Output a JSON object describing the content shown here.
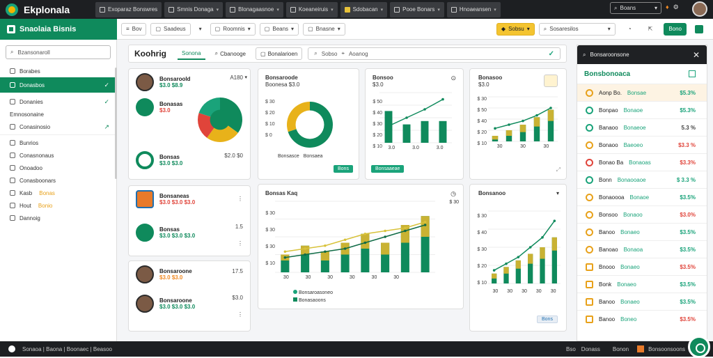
{
  "app": {
    "name": "Ekplonala"
  },
  "top_tabs": [
    {
      "label": "Exoparaz Bonswres"
    },
    {
      "label": "Smnis Donaga"
    },
    {
      "label": "Blonagaasnoe"
    },
    {
      "label": "Koeaneiruis"
    },
    {
      "label": "Sdobacan"
    },
    {
      "label": "Pooe Bonars"
    },
    {
      "label": "Hnoaeansen"
    }
  ],
  "top_search": {
    "placeholder": "Boans"
  },
  "brand": {
    "title": "Snaolaia Bisnis"
  },
  "toolbar": {
    "menu": "Bov",
    "b1": "Saadeus",
    "b2": "Roomnis",
    "b3": "Beans",
    "b4": "Bnasne",
    "b5": "Sobsu",
    "search": "Sosaresilos",
    "action": "Bono"
  },
  "sidebar": {
    "search": "Bzansonaroll",
    "items": [
      {
        "label": "Borabes",
        "trail": ""
      },
      {
        "label": "Donasbos",
        "trail": "✓"
      },
      {
        "label": "Donanies",
        "trail": "✓"
      },
      {
        "label": "Emnosonaine",
        "trail": ""
      },
      {
        "label": "Conasinosio",
        "trail": "↗"
      },
      {
        "label": "Bunrios",
        "trail": ""
      },
      {
        "label": "Conasnonaus",
        "trail": ""
      },
      {
        "label": "Onoadoo",
        "trail": ""
      },
      {
        "label": "Conasboonars",
        "trail": ""
      },
      {
        "label": "Kasb",
        "tag": "Bonas",
        "trail": ""
      },
      {
        "label": "Hout",
        "tag": "Bonio",
        "trail": ""
      },
      {
        "label": "Dannoig",
        "trail": ""
      }
    ]
  },
  "main": {
    "title": "Koohrig",
    "tab_active": "Sonona",
    "tab2": "Cbanooge",
    "tab3": "Bonalarioen",
    "search1": "Sobso",
    "search2": "Aoanog"
  },
  "card_people": {
    "rows": [
      {
        "name": "Bonsaroold",
        "sub": "$3.0 $8.9",
        "num": "A180"
      },
      {
        "name": "Bonasas",
        "sub": "$3.0"
      },
      {
        "name": "Bonsas",
        "sub": "$3.0 $3.0",
        "num": "$2.0 $0"
      }
    ]
  },
  "card_donut": {
    "title": "Bonsaroode",
    "subtitle": "Boonesa $3.0",
    "yticks": [
      "$ 30",
      "$ 20",
      "$ 10",
      "$ 0"
    ],
    "legend": [
      "Bonsasce",
      "Bonsaea"
    ],
    "action": "Bons"
  },
  "card_bar1": {
    "title": "Bonsoo",
    "sub": "$3.0",
    "yticks": [
      "$ 50",
      "$ 40",
      "$ 30",
      "$ 20",
      "$ 10"
    ],
    "xticks": [
      "3.0",
      "3.0",
      "3.0"
    ],
    "action": "Bonsaaeae"
  },
  "card_bar2": {
    "title": "Bonasoo",
    "sub": "$3.0",
    "yticks": [
      "$ 30",
      "$ 50",
      "$ 40",
      "$ 20",
      "$ 10"
    ],
    "xticks": [
      "30",
      "30",
      "30"
    ]
  },
  "card_stores": {
    "rows": [
      {
        "name": "Bonsaneas",
        "sub": "$3.0 $3.0 $3.0"
      },
      {
        "name": "Bonsas",
        "sub": "$3.0 $3.0 $3.0",
        "num": "1.5"
      },
      {
        "name": "Bonsaroone",
        "num": "17.5"
      },
      {
        "name": "Bonsaroone",
        "sub": "$3.0 $3.0 $3.0",
        "num": "$3.0"
      }
    ]
  },
  "card_combo": {
    "title": "Bonsas Kaq",
    "yticks": [
      "$ 30",
      "$ 30",
      "$ 30",
      "$ 10"
    ],
    "xticks": [
      "30",
      "30",
      "30",
      "30",
      "30",
      "30"
    ],
    "legend": [
      "Bonsaroasoneo",
      "Bonasaoons"
    ],
    "note": "$ 30"
  },
  "card_combo2": {
    "title": "Bonsanoo",
    "yticks": [
      "$ 30",
      "$ 40",
      "$ 30",
      "$ 20",
      "$ 10"
    ],
    "xticks": [
      "30",
      "30",
      "30",
      "30",
      "30"
    ],
    "action": "Bons"
  },
  "right": {
    "header": "Bonsaroonsone",
    "sub": "Bonsbonoaca",
    "rows": [
      {
        "name": "Aonp Bo.",
        "sub": "Bonsae",
        "val": "$5.3%",
        "vc": "g",
        "ic": "y",
        "hi": true
      },
      {
        "name": "Bonpao",
        "sub": "Bonaoe",
        "val": "$5.3%",
        "vc": "g",
        "ic": "g"
      },
      {
        "name": "Banaoo",
        "sub": "Bonaeoe",
        "val": "5.3 %",
        "vc": "k",
        "ic": "g"
      },
      {
        "name": "Bonaoo",
        "sub": "Baeoeo",
        "val": "$3.3 %",
        "vc": "r",
        "ic": "y"
      },
      {
        "name": "Bonao Ba",
        "sub": "Bonaoas",
        "val": "$3.3%",
        "vc": "r",
        "ic": "o"
      },
      {
        "name": "Bonn",
        "sub": "Bonaooaoe",
        "val": "$ 3.3 %",
        "vc": "g",
        "ic": "g"
      },
      {
        "name": "Bonaoooa",
        "sub": "Bonaoe",
        "val": "$3.5%",
        "vc": "g",
        "ic": "y"
      },
      {
        "name": "Bonsoo",
        "sub": "Bonaoo",
        "val": "$3.0%",
        "vc": "r",
        "ic": "y"
      },
      {
        "name": "Banoo",
        "sub": "Bonaeo",
        "val": "$3.5%",
        "vc": "g",
        "ic": "y"
      },
      {
        "name": "Banoao",
        "sub": "Bonaoa",
        "val": "$3.5%",
        "vc": "g",
        "ic": "y"
      },
      {
        "name": "Bnooo",
        "sub": "Bonaeo",
        "val": "$3.5%",
        "vc": "r",
        "ic": "y"
      },
      {
        "name": "Bonk",
        "sub": "Bonaeo",
        "val": "$3.5%",
        "vc": "g",
        "ic": "y"
      },
      {
        "name": "Banoo",
        "sub": "Bonaeo",
        "val": "$3.5%",
        "vc": "g",
        "ic": "y"
      },
      {
        "name": "Banoo",
        "sub": "Boneo",
        "val": "$3.5%",
        "vc": "r",
        "ic": "y"
      }
    ]
  },
  "bottom": {
    "left": "Sonaoa | Baona | Boonaec | Beasoo",
    "right1": "Bso",
    "right2": "Donass",
    "right3": "Bonon",
    "right4": "Bonsoonsoons"
  },
  "colors": {
    "primary": "#0f8a5c",
    "accent": "#f4b400",
    "alert": "#e0443a",
    "dark": "#1d1f22"
  },
  "chart_data": [
    {
      "type": "pie",
      "values": [
        35,
        25,
        20,
        20
      ]
    },
    {
      "type": "pie",
      "values": [
        70,
        30
      ]
    },
    {
      "type": "bar",
      "x": [
        1,
        2,
        3,
        4
      ],
      "values": [
        38,
        22,
        26,
        26
      ],
      "line": [
        20,
        30,
        40,
        52
      ]
    },
    {
      "type": "bar",
      "x": [
        1,
        2,
        3,
        4,
        5
      ],
      "series": [
        {
          "values": [
            6,
            12,
            18,
            26,
            34
          ]
        },
        {
          "values": [
            4,
            6,
            8,
            10,
            12
          ]
        }
      ],
      "line": [
        14,
        18,
        22,
        28,
        36
      ]
    },
    {
      "type": "bar",
      "x": [
        1,
        2,
        3,
        4,
        5,
        6,
        7,
        8
      ],
      "series": [
        {
          "values": [
            12,
            18,
            14,
            20,
            26,
            20,
            32,
            38
          ]
        },
        {
          "values": [
            4,
            6,
            6,
            8,
            10,
            8,
            12,
            14
          ]
        }
      ],
      "line": [
        14,
        16,
        18,
        22,
        26,
        28,
        30,
        34
      ],
      "line2": [
        10,
        12,
        14,
        16,
        20,
        24,
        28,
        32
      ]
    },
    {
      "type": "bar",
      "x": [
        1,
        2,
        3,
        4,
        5,
        6
      ],
      "series": [
        {
          "values": [
            6,
            10,
            14,
            18,
            22,
            28
          ]
        },
        {
          "values": [
            3,
            4,
            5,
            6,
            7,
            8
          ]
        }
      ],
      "line": [
        8,
        12,
        16,
        22,
        28,
        38
      ]
    }
  ]
}
